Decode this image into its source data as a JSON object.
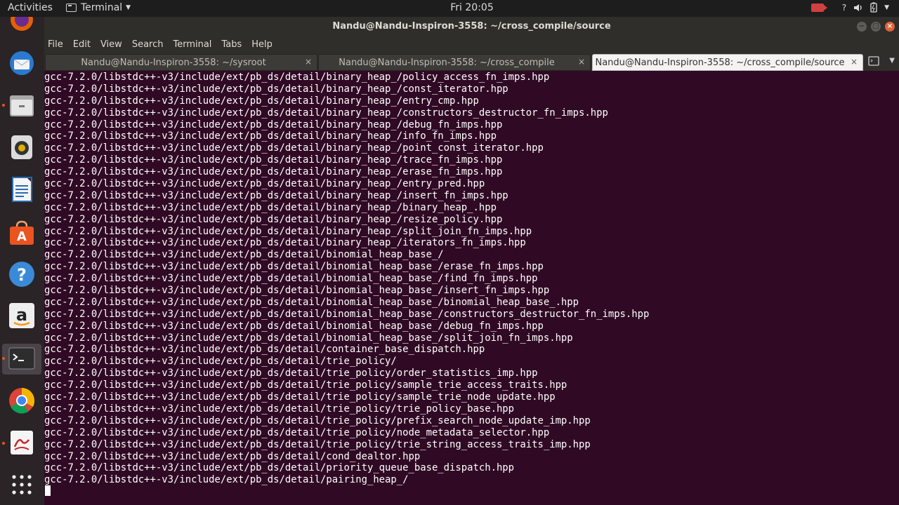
{
  "topbar": {
    "activities": "Activities",
    "app_name": "Terminal",
    "clock": "Fri 20:05",
    "tray_help": "?"
  },
  "window": {
    "title": "Nandu@Nandu-Inspiron-3558: ~/cross_compile/source"
  },
  "menu": [
    "File",
    "Edit",
    "View",
    "Search",
    "Terminal",
    "Tabs",
    "Help"
  ],
  "tabs": [
    {
      "label": "Nandu@Nandu-Inspiron-3558: ~/sysroot"
    },
    {
      "label": "Nandu@Nandu-Inspiron-3558: ~/cross_compile"
    },
    {
      "label": "Nandu@Nandu-Inspiron-3558: ~/cross_compile/source"
    }
  ],
  "dock": [
    {
      "name": "firefox"
    },
    {
      "name": "thunderbird"
    },
    {
      "name": "files"
    },
    {
      "name": "rhythmbox"
    },
    {
      "name": "libreoffice-writer"
    },
    {
      "name": "ubuntu-software"
    },
    {
      "name": "help"
    },
    {
      "name": "amazon"
    },
    {
      "name": "terminal"
    },
    {
      "name": "chrome"
    },
    {
      "name": "evince"
    },
    {
      "name": "show-applications"
    }
  ],
  "terminal_lines": [
    "gcc-7.2.0/libstdc++-v3/include/ext/pb_ds/detail/binary_heap_/policy_access_fn_imps.hpp",
    "gcc-7.2.0/libstdc++-v3/include/ext/pb_ds/detail/binary_heap_/const_iterator.hpp",
    "gcc-7.2.0/libstdc++-v3/include/ext/pb_ds/detail/binary_heap_/entry_cmp.hpp",
    "gcc-7.2.0/libstdc++-v3/include/ext/pb_ds/detail/binary_heap_/constructors_destructor_fn_imps.hpp",
    "gcc-7.2.0/libstdc++-v3/include/ext/pb_ds/detail/binary_heap_/debug_fn_imps.hpp",
    "gcc-7.2.0/libstdc++-v3/include/ext/pb_ds/detail/binary_heap_/info_fn_imps.hpp",
    "gcc-7.2.0/libstdc++-v3/include/ext/pb_ds/detail/binary_heap_/point_const_iterator.hpp",
    "gcc-7.2.0/libstdc++-v3/include/ext/pb_ds/detail/binary_heap_/trace_fn_imps.hpp",
    "gcc-7.2.0/libstdc++-v3/include/ext/pb_ds/detail/binary_heap_/erase_fn_imps.hpp",
    "gcc-7.2.0/libstdc++-v3/include/ext/pb_ds/detail/binary_heap_/entry_pred.hpp",
    "gcc-7.2.0/libstdc++-v3/include/ext/pb_ds/detail/binary_heap_/insert_fn_imps.hpp",
    "gcc-7.2.0/libstdc++-v3/include/ext/pb_ds/detail/binary_heap_/binary_heap_.hpp",
    "gcc-7.2.0/libstdc++-v3/include/ext/pb_ds/detail/binary_heap_/resize_policy.hpp",
    "gcc-7.2.0/libstdc++-v3/include/ext/pb_ds/detail/binary_heap_/split_join_fn_imps.hpp",
    "gcc-7.2.0/libstdc++-v3/include/ext/pb_ds/detail/binary_heap_/iterators_fn_imps.hpp",
    "gcc-7.2.0/libstdc++-v3/include/ext/pb_ds/detail/binomial_heap_base_/",
    "gcc-7.2.0/libstdc++-v3/include/ext/pb_ds/detail/binomial_heap_base_/erase_fn_imps.hpp",
    "gcc-7.2.0/libstdc++-v3/include/ext/pb_ds/detail/binomial_heap_base_/find_fn_imps.hpp",
    "gcc-7.2.0/libstdc++-v3/include/ext/pb_ds/detail/binomial_heap_base_/insert_fn_imps.hpp",
    "gcc-7.2.0/libstdc++-v3/include/ext/pb_ds/detail/binomial_heap_base_/binomial_heap_base_.hpp",
    "gcc-7.2.0/libstdc++-v3/include/ext/pb_ds/detail/binomial_heap_base_/constructors_destructor_fn_imps.hpp",
    "gcc-7.2.0/libstdc++-v3/include/ext/pb_ds/detail/binomial_heap_base_/debug_fn_imps.hpp",
    "gcc-7.2.0/libstdc++-v3/include/ext/pb_ds/detail/binomial_heap_base_/split_join_fn_imps.hpp",
    "gcc-7.2.0/libstdc++-v3/include/ext/pb_ds/detail/container_base_dispatch.hpp",
    "gcc-7.2.0/libstdc++-v3/include/ext/pb_ds/detail/trie_policy/",
    "gcc-7.2.0/libstdc++-v3/include/ext/pb_ds/detail/trie_policy/order_statistics_imp.hpp",
    "gcc-7.2.0/libstdc++-v3/include/ext/pb_ds/detail/trie_policy/sample_trie_access_traits.hpp",
    "gcc-7.2.0/libstdc++-v3/include/ext/pb_ds/detail/trie_policy/sample_trie_node_update.hpp",
    "gcc-7.2.0/libstdc++-v3/include/ext/pb_ds/detail/trie_policy/trie_policy_base.hpp",
    "gcc-7.2.0/libstdc++-v3/include/ext/pb_ds/detail/trie_policy/prefix_search_node_update_imp.hpp",
    "gcc-7.2.0/libstdc++-v3/include/ext/pb_ds/detail/trie_policy/node_metadata_selector.hpp",
    "gcc-7.2.0/libstdc++-v3/include/ext/pb_ds/detail/trie_policy/trie_string_access_traits_imp.hpp",
    "gcc-7.2.0/libstdc++-v3/include/ext/pb_ds/detail/cond_dealtor.hpp",
    "gcc-7.2.0/libstdc++-v3/include/ext/pb_ds/detail/priority_queue_base_dispatch.hpp",
    "gcc-7.2.0/libstdc++-v3/include/ext/pb_ds/detail/pairing_heap_/"
  ],
  "colors": {
    "terminal_bg": "#300a24",
    "terminal_fg": "#ffffff",
    "accent": "#e95420"
  }
}
